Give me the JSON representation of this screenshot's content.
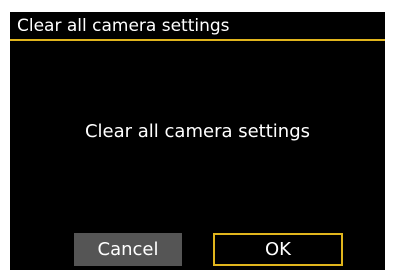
{
  "dialog": {
    "title": "Clear all camera settings",
    "message": "Clear all camera settings",
    "buttons": {
      "cancel_label": "Cancel",
      "ok_label": "OK",
      "selected": "OK"
    }
  },
  "colors": {
    "background": "#000000",
    "text": "#ffffff",
    "accent": "#e1b51d",
    "button_inactive": "#555555"
  }
}
